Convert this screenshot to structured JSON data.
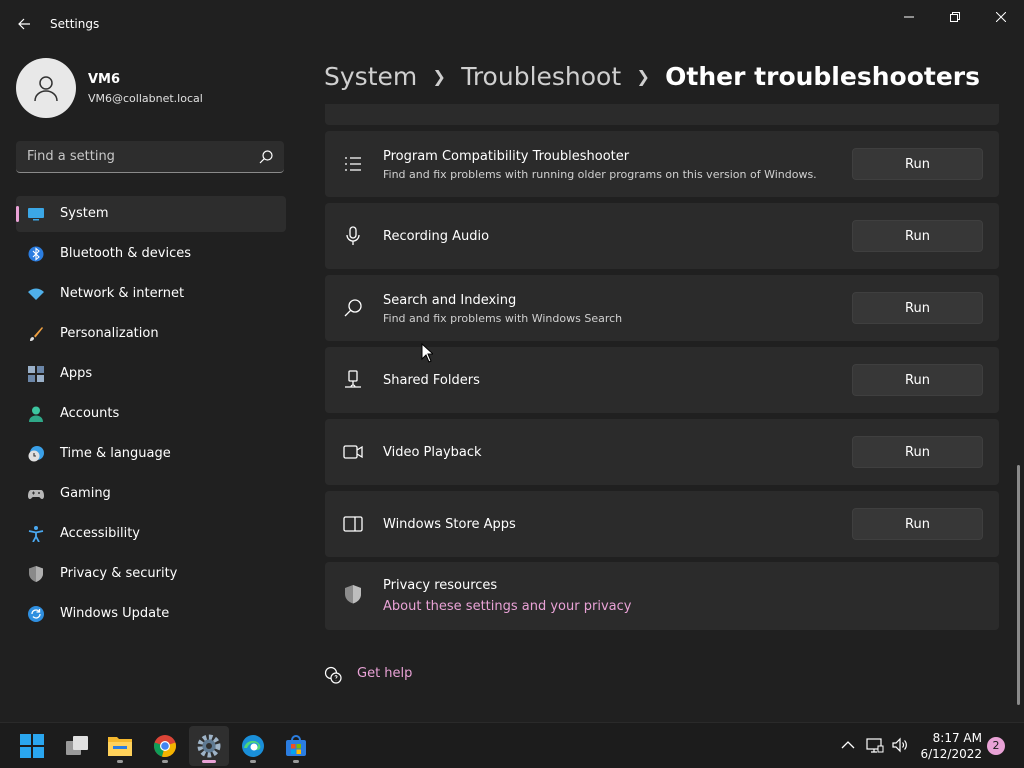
{
  "window": {
    "title": "Settings"
  },
  "profile": {
    "name": "VM6",
    "email": "VM6@collabnet.local"
  },
  "search": {
    "placeholder": "Find a setting"
  },
  "sidebar": {
    "items": [
      {
        "label": "System",
        "icon": "system-icon"
      },
      {
        "label": "Bluetooth & devices",
        "icon": "bluetooth-icon"
      },
      {
        "label": "Network & internet",
        "icon": "wifi-icon"
      },
      {
        "label": "Personalization",
        "icon": "brush-icon"
      },
      {
        "label": "Apps",
        "icon": "apps-icon"
      },
      {
        "label": "Accounts",
        "icon": "person-icon"
      },
      {
        "label": "Time & language",
        "icon": "clock-globe-icon"
      },
      {
        "label": "Gaming",
        "icon": "gamepad-icon"
      },
      {
        "label": "Accessibility",
        "icon": "accessibility-icon"
      },
      {
        "label": "Privacy & security",
        "icon": "shield-icon"
      },
      {
        "label": "Windows Update",
        "icon": "update-icon"
      }
    ],
    "selected": "System"
  },
  "breadcrumb": {
    "items": [
      "System",
      "Troubleshoot",
      "Other troubleshooters"
    ]
  },
  "troubleshooters": [
    {
      "title": "Program Compatibility Troubleshooter",
      "description": "Find and fix problems with running older programs on this version of Windows.",
      "button": "Run",
      "icon": "list-icon"
    },
    {
      "title": "Recording Audio",
      "description": "",
      "button": "Run",
      "icon": "microphone-icon"
    },
    {
      "title": "Search and Indexing",
      "description": "Find and fix problems with Windows Search",
      "button": "Run",
      "icon": "search-icon"
    },
    {
      "title": "Shared Folders",
      "description": "",
      "button": "Run",
      "icon": "network-drive-icon"
    },
    {
      "title": "Video Playback",
      "description": "",
      "button": "Run",
      "icon": "video-camera-icon"
    },
    {
      "title": "Windows Store Apps",
      "description": "",
      "button": "Run",
      "icon": "store-app-icon"
    }
  ],
  "privacy": {
    "title": "Privacy resources",
    "link": "About these settings and your privacy"
  },
  "help": {
    "label": "Get help"
  },
  "taskbar": {
    "apps": [
      "start-icon",
      "task-view-icon",
      "file-explorer-icon",
      "chrome-icon",
      "settings-icon",
      "edge-icon",
      "microsoft-store-icon"
    ],
    "time": "8:17 AM",
    "date": "6/12/2022",
    "notification_count": "2"
  },
  "colors": {
    "accent": "#e9a2d6",
    "background": "#202020",
    "card": "#2b2b2b"
  }
}
